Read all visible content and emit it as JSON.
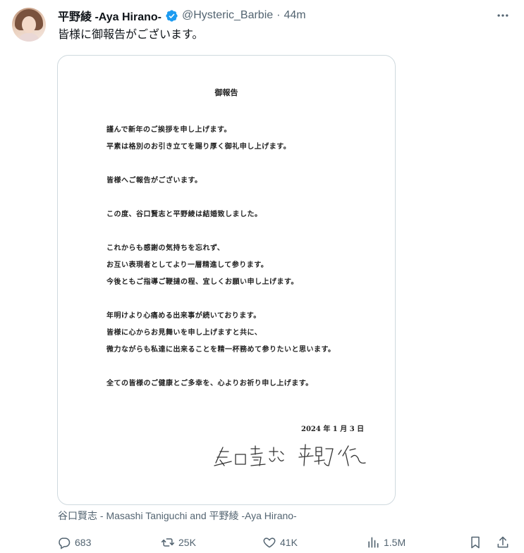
{
  "author": {
    "name": "平野綾 -Aya Hirano-",
    "handle": "@Hysteric_Barbie",
    "separator": "·",
    "time": "44m",
    "verified_color": "#1d9bf0"
  },
  "tweet": {
    "text": "皆様に御報告がございます。"
  },
  "letter": {
    "title": "御報告",
    "lines": [
      "謹んで新年のご挨拶を申し上げます。",
      "平素は格別のお引き立てを賜り厚く御礼申し上げます。",
      "皆様へご報告がございます。",
      "この度、谷口賢志と平野綾は結婚致しました。",
      "これからも感謝の気持ちを忘れず、",
      "お互い表現者としてより一層精進して参ります。",
      "今後ともご指導ご鞭撻の程、宜しくお願い申し上げます。",
      "年明けより心痛める出来事が続いております。",
      "皆様に心からお見舞いを申し上げますと共に、",
      "微力ながらも私達に出来ることを精一杯務めて参りたいと思います。",
      "全ての皆様のご健康とご多幸を、心よりお祈り申し上げます。"
    ],
    "date": "2024 年 1 月 3 日",
    "signature": "谷口賢志 平野綾"
  },
  "media_caption": "谷口賢志 - Masashi Taniguchi and 平野綾 -Aya Hirano-",
  "actions": {
    "replies": "683",
    "retweets": "25K",
    "likes": "41K",
    "views": "1.5M",
    "reply_icon": "reply-icon",
    "retweet_icon": "retweet-icon",
    "like_icon": "heart-icon",
    "views_icon": "views-icon",
    "bookmark_icon": "bookmark-icon",
    "share_icon": "share-icon"
  },
  "colors": {
    "text": "#0f1419",
    "muted": "#536471",
    "border": "#cfd9de"
  }
}
